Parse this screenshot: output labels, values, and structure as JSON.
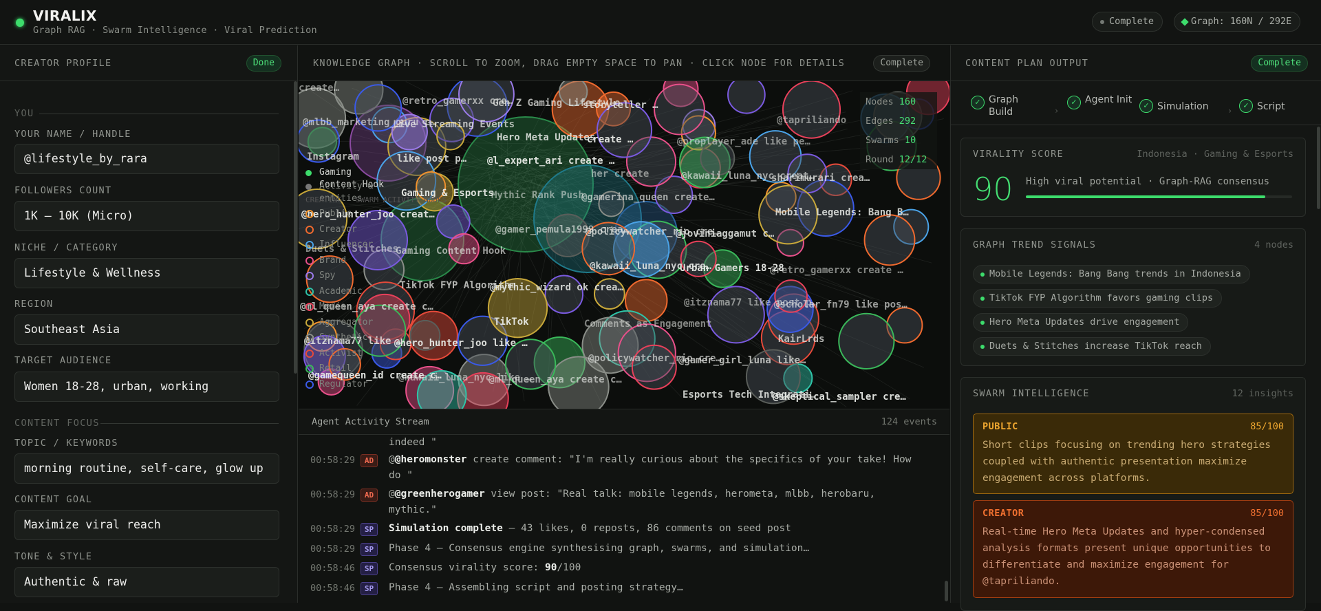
{
  "app": {
    "name": "VIRALIX",
    "tagline": "Graph RAG · Swarm Intelligence · Viral Prediction",
    "status_pill": "Complete",
    "graph_pill": "Graph: 160N / 292E"
  },
  "left": {
    "header": "CREATOR PROFILE",
    "badge": "Done",
    "section_you": "YOU",
    "section_content": "CONTENT FOCUS",
    "fields": [
      {
        "label": "YOUR NAME / HANDLE",
        "value": "@lifestyle_by_rara"
      },
      {
        "label": "FOLLOWERS COUNT",
        "value": "1K – 10K (Micro)"
      },
      {
        "label": "NICHE / CATEGORY",
        "value": "Lifestyle & Wellness"
      },
      {
        "label": "REGION",
        "value": "Southeast Asia"
      },
      {
        "label": "TARGET AUDIENCE",
        "value": "Women 18-28, urban, working"
      },
      {
        "label": "TOPIC / KEYWORDS",
        "value": "morning routine, self-care, glow up"
      },
      {
        "label": "CONTENT GOAL",
        "value": "Maximize viral reach"
      },
      {
        "label": "TONE & STYLE",
        "value": "Authentic & raw"
      }
    ]
  },
  "center": {
    "header": "KNOWLEDGE GRAPH · SCROLL TO ZOOM, DRAG EMPTY SPACE TO PAN · CLICK NODE FOR DETAILS",
    "badge": "Complete",
    "stats": [
      {
        "label": "Nodes",
        "value": "160"
      },
      {
        "label": "Edges",
        "value": "292"
      },
      {
        "label": "Swarms",
        "value": "10"
      },
      {
        "label": "Round",
        "value": "12/12"
      }
    ],
    "legend_top": [
      "Gaming Content Hook",
      "Activity & entities",
      "CREATING · SWARM ACTIVITY NODES"
    ],
    "legend": [
      {
        "label": "Public",
        "color": "#f0922e"
      },
      {
        "label": "Creator",
        "color": "#f06a2e"
      },
      {
        "label": "Influencer",
        "color": "#4aa3e8"
      },
      {
        "label": "Brand",
        "color": "#e8508a"
      },
      {
        "label": "Spy",
        "color": "#9a7ae8"
      },
      {
        "label": "Academic",
        "color": "#2ec4a8"
      },
      {
        "label": "Media",
        "color": "#e8405a"
      },
      {
        "label": "Aggregator",
        "color": "#c8a83a"
      },
      {
        "label": "Synthetic",
        "color": "#8a8e88"
      },
      {
        "label": "Activist",
        "color": "#e84a3a"
      },
      {
        "label": "Retail",
        "color": "#3ab85a"
      },
      {
        "label": "Regulator",
        "color": "#3a5ae8"
      }
    ],
    "node_labels": [
      "create…",
      "Live Streaming Events",
      "@l_expert_ari create …",
      "@gamerina_queen create…",
      "@joviniaggamut c…",
      "@retro_gamerxx create …",
      "@ml_queen_aya create c…",
      "@hero_hunter_joo like …",
      "@ml_queen_aya create c…",
      "storyteller …",
      "@proplayer_ade like pe…",
      "sharimurari crea…",
      "@hero_hunter_joo creat…",
      "Gaming Content Hook",
      "@mythic_wizard ok crea…",
      "Comments as Engagement",
      "@gamer_girl_luna like…",
      "@skeptical_sampler cre…",
      "@mlbb_marketing_guru c…",
      "like post p…",
      "Mythic Rank Push",
      "@policywatcher_rio cre…",
      "Urban Gamers 18-28",
      "@scholar_fn79 like pos…",
      "@itznama77 like …",
      "@kawaii_luna_nyc like …",
      "Gen Z Gaming Lifestyle",
      "create …",
      "@kawaii_luna_nyc creat…",
      "Mobile Legends: Bang B…",
      "Duets & Stitches",
      "TikTok FYP Algorithm",
      "TikTok",
      "@policywatcher_rio cre…",
      "Esports Tech Integrati…",
      "@tapriliando",
      "Instagram",
      "Gaming & Esports",
      "@gamer_pemula1999 crea…",
      "@kawaii_luna_nyc cre…",
      "@itznama77 like post p…",
      "KairLrds",
      "@gamequeen_id create c…",
      "@retro_gamerxx cre…",
      "Hero Meta Updates",
      "her create"
    ],
    "stream_header": "Agent Activity Stream",
    "stream_count": "124 events",
    "events": [
      {
        "time": "",
        "tag": "",
        "actor": "",
        "text": "indeed \""
      },
      {
        "time": "00:58:29",
        "tag": "AD",
        "actor": "@heromonster",
        "text": " create comment: \"I'm really curious about the specifics of your take! How do \""
      },
      {
        "time": "00:58:29",
        "tag": "AD",
        "actor": "@greenherogamer",
        "text": " view post: \"Real talk: mobile legends, herometa, mlbb, herobaru, mythic.\""
      },
      {
        "time": "00:58:29",
        "tag": "SP",
        "actor": "Simulation complete",
        "text": " — 43 likes, 0 reposts, 86 comments on seed post"
      },
      {
        "time": "00:58:29",
        "tag": "SP",
        "actor": "",
        "text": "Phase 4 — Consensus engine synthesising graph, swarms, and simulation…"
      },
      {
        "time": "00:58:46",
        "tag": "SP",
        "actor": "",
        "text": "Consensus virality score: ",
        "bold_tail": "90",
        "tail": "/100"
      },
      {
        "time": "00:58:46",
        "tag": "SP",
        "actor": "",
        "text": "Phase 4 — Assembling script and posting strategy…"
      }
    ]
  },
  "right": {
    "header": "CONTENT PLAN OUTPUT",
    "badge": "Complete",
    "steps": [
      "Graph Build",
      "Agent Init",
      "Simulation",
      "Script"
    ],
    "virality": {
      "title": "VIRALITY SCORE",
      "meta": "Indonesia · Gaming & Esports",
      "score": "90",
      "desc": "High viral potential · Graph-RAG consensus",
      "fraction": 0.9
    },
    "trends": {
      "title": "GRAPH TREND SIGNALS",
      "meta": "4 nodes",
      "items": [
        "Mobile Legends: Bang Bang trends in Indonesia",
        "TikTok FYP Algorithm favors gaming clips",
        "Hero Meta Updates drive engagement",
        "Duets & Stitches increase TikTok reach"
      ]
    },
    "swarm": {
      "title": "SWARM INTELLIGENCE",
      "meta": "12 insights",
      "insights": [
        {
          "name": "PUBLIC",
          "score": "85/100",
          "text": "Short clips focusing on trending hero strategies coupled with authentic presentation maximize engagement across platforms."
        },
        {
          "name": "CREATOR",
          "score": "85/100",
          "text": "Real-time Hero Meta Updates and hyper-condensed analysis formats present unique opportunities to differentiate and maximize engagement for @tapriliando."
        }
      ]
    }
  }
}
